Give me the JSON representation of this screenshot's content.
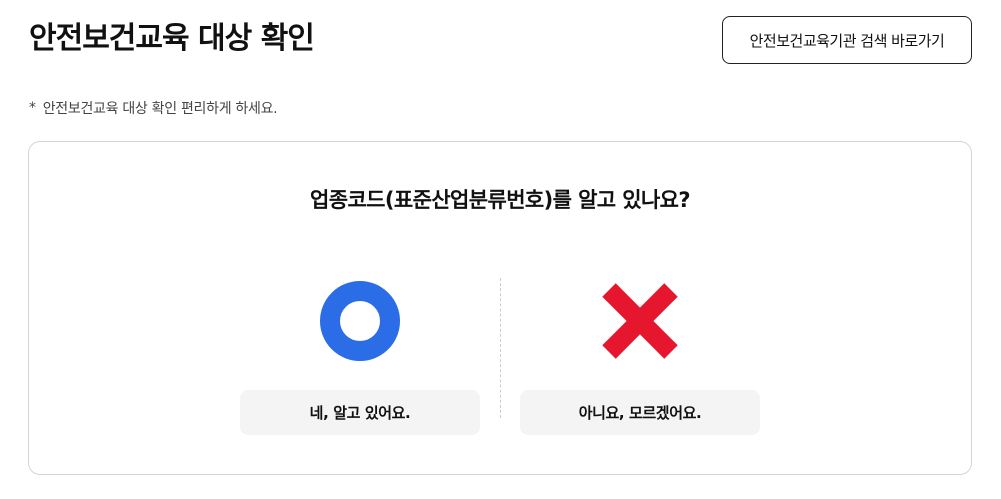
{
  "header": {
    "title": "안전보건교육 대상 확인",
    "org_search_label": "안전보건교육기관 검색 바로가기"
  },
  "notice": {
    "marker": "*",
    "text": "안전보건교육 대상 확인 편리하게 하세요."
  },
  "quiz": {
    "question": "업종코드(표준산업분류번호)를 알고 있나요?",
    "options": [
      {
        "label": "네, 알고 있어요.",
        "icon": "circle-o-icon",
        "color": "#2b6de6"
      },
      {
        "label": "아니요, 모르겠어요.",
        "icon": "cross-x-icon",
        "color": "#e5162e"
      }
    ]
  }
}
